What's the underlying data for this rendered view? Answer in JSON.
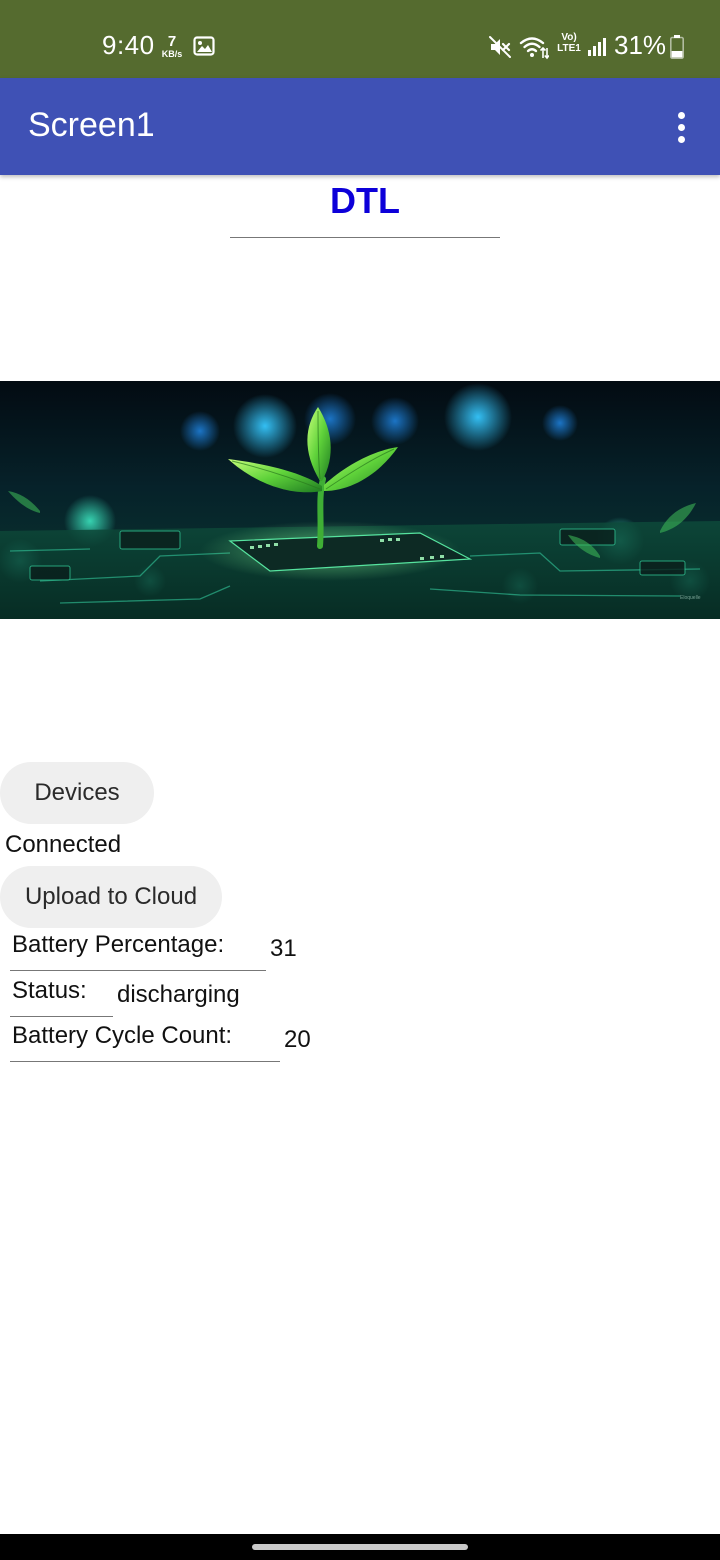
{
  "status_bar": {
    "time": "9:40",
    "net_speed_value": "7",
    "net_speed_unit": "KB/s",
    "volte_line1": "Vo)",
    "volte_line2": "LTE1",
    "battery_percent": "31%",
    "icons": [
      "gallery-icon",
      "mute-icon",
      "wifi-icon",
      "signal-icon",
      "battery-icon"
    ],
    "background_color": "#556b2f"
  },
  "app_bar": {
    "title": "Screen1",
    "menu_icon": "overflow-menu-icon",
    "background_color": "#3f51b5"
  },
  "main": {
    "heading": "DTL",
    "heading_color": "#0d00d9",
    "image_watermark": "Eloquelle",
    "devices_button_label": "Devices",
    "connection_status": "Connected",
    "upload_button_label": "Upload to Cloud",
    "fields": [
      {
        "label": "Battery Percentage:",
        "value": "31"
      },
      {
        "label": "Status:",
        "value": "discharging"
      },
      {
        "label": "Battery Cycle Count:",
        "value": "20"
      }
    ]
  }
}
